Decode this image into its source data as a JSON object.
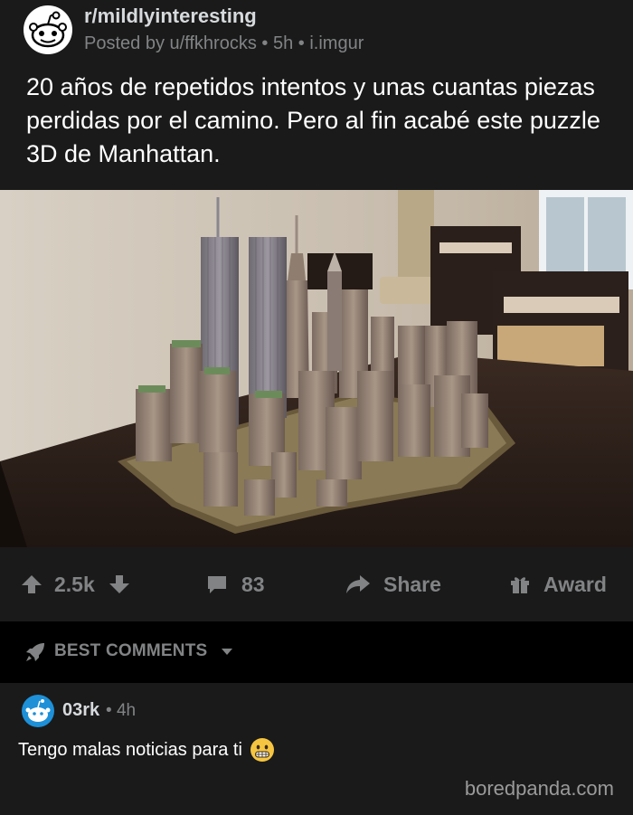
{
  "post": {
    "subreddit": "r/mildlyinteresting",
    "posted_by": "Posted by u/ffkhrocks",
    "age": "5h",
    "domain": "i.imgur",
    "title": "20 años de repetidos intentos y unas cuantas piezas perdidas por el camino. Pero al fin acabé este puzzle 3D de Manhattan."
  },
  "actions": {
    "score": "2.5k",
    "comments": "83",
    "share": "Share",
    "award": "Award"
  },
  "sort": {
    "label": "BEST COMMENTS"
  },
  "comment": {
    "author": "03rk",
    "age": "4h",
    "body": "Tengo malas noticias para ti"
  },
  "watermark": "boredpanda.com",
  "icons": {
    "subreddit": "reddit-alien-icon",
    "upvote": "arrow-up-icon",
    "downvote": "arrow-down-icon",
    "comments": "speech-bubble-icon",
    "share": "share-arrow-icon",
    "award": "gift-icon",
    "sort": "rocket-icon",
    "dropdown": "caret-down-icon",
    "emoji": "grimacing-face-icon"
  },
  "colors": {
    "background": "#000000",
    "card": "#1a1a1b",
    "text": "#d7dadc",
    "muted": "#818384",
    "avatar_blue": "#1e90d8",
    "emoji_yellow": "#f5c542"
  }
}
